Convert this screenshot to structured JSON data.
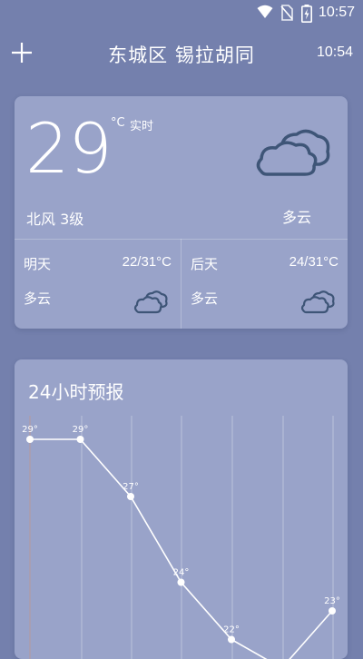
{
  "status_bar": {
    "time": "10:57",
    "icons": [
      "wifi-icon",
      "no-sim-icon",
      "battery-charging-icon"
    ]
  },
  "header": {
    "add_icon": "plus-icon",
    "location": "东城区 锡拉胡同",
    "update_time": "10:54"
  },
  "current": {
    "temperature": "29",
    "unit": "°C",
    "realtime_label": "实时",
    "wind": "北风 3级",
    "condition": "多云",
    "icon": "cloud-icon"
  },
  "daily": [
    {
      "label": "明天",
      "temp": "22/31°C",
      "condition": "多云",
      "icon": "cloud-icon"
    },
    {
      "label": "后天",
      "temp": "24/31°C",
      "condition": "多云",
      "icon": "cloud-icon"
    }
  ],
  "forecast": {
    "title": "24小时预报"
  },
  "chart_data": {
    "type": "line",
    "title": "24小时预报",
    "unit": "°",
    "values": [
      29,
      29,
      27,
      24,
      22,
      21,
      23
    ],
    "labels": [
      "29°",
      "29°",
      "27°",
      "24°",
      "22°",
      "",
      "23°"
    ]
  },
  "colors": {
    "background": "#7480ad",
    "card": "#99a3c9",
    "text": "#ffffff",
    "icon_stroke": "#3e5577"
  }
}
